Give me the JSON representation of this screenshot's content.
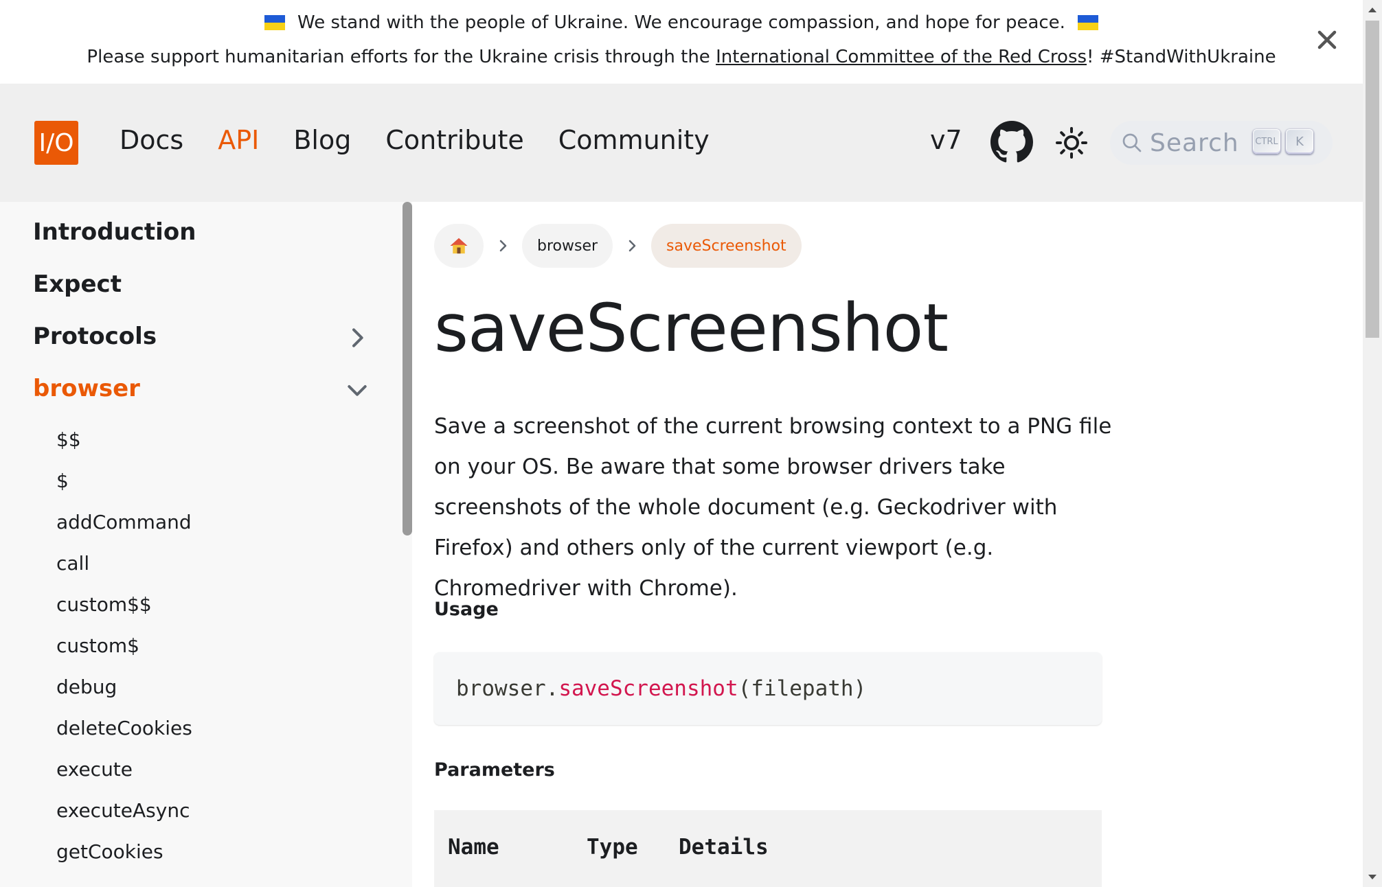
{
  "banner": {
    "line1": "We stand with the people of Ukraine. We encourage compassion, and hope for peace.",
    "line2_prefix": "Please support humanitarian efforts for the Ukraine crisis through the ",
    "line2_link": "International Committee of the Red Cross",
    "line2_suffix": "! #StandWithUkraine"
  },
  "navbar": {
    "logo_text": "I/O",
    "links": [
      "Docs",
      "API",
      "Blog",
      "Contribute",
      "Community"
    ],
    "active_link": "API",
    "version": "v7",
    "search_placeholder": "Search",
    "kbd_ctrl": "CTRL",
    "kbd_k": "K",
    "accent_color": "#ea5906"
  },
  "sidebar": {
    "top_items": [
      "Introduction",
      "Expect",
      "Protocols",
      "browser"
    ],
    "active_item": "browser",
    "sub_items": [
      "$$",
      "$",
      "addCommand",
      "call",
      "custom$$",
      "custom$",
      "debug",
      "deleteCookies",
      "execute",
      "executeAsync",
      "getCookies"
    ]
  },
  "breadcrumbs": [
    "browser",
    "saveScreenshot"
  ],
  "main": {
    "title": "saveScreenshot",
    "description": "Save a screenshot of the current browsing context to a PNG file on your OS. Be aware that some browser drivers take screenshots of the whole document (e.g. Geckodriver with Firefox) and others only of the current viewport (e.g. Chromedriver with Chrome).",
    "usage_heading": "Usage",
    "code_obj": "browser.",
    "code_fn": "saveScreenshot",
    "code_args": "(filepath)",
    "params_heading": "Parameters",
    "table_headers": [
      "Name",
      "Type",
      "Details"
    ]
  }
}
